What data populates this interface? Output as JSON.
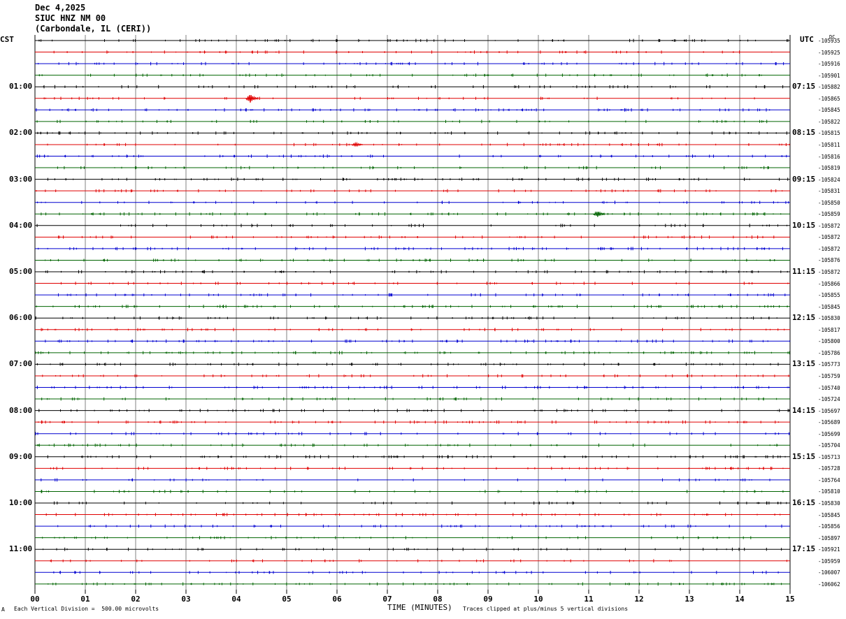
{
  "header": {
    "date": "Dec 4,2025",
    "station": "SIUC HNZ NM 00",
    "location": "(Carbondale, IL (CERI))"
  },
  "labels": {
    "left_zone": "CST",
    "right_zone": "UTC",
    "dc": "DC",
    "xlabel": "TIME (MINUTES)",
    "scale_note": "Each Vertical Division =  500.00 microvolts",
    "clip_note": "Traces clipped at plus/minus 5 vertical divisions",
    "corner_mark": "A"
  },
  "colors": {
    "black": "#000000",
    "red": "#e00000",
    "blue": "#0000d0",
    "green": "#006400",
    "grid": "#808080"
  },
  "chart_data": {
    "type": "line",
    "title": "SIUC HNZ NM 00",
    "xlabel": "TIME (MINUTES)",
    "x_ticks": [
      "00",
      "01",
      "02",
      "03",
      "04",
      "05",
      "06",
      "07",
      "08",
      "09",
      "10",
      "11",
      "12",
      "13",
      "14",
      "15"
    ],
    "xlim": [
      0,
      15
    ],
    "trace_count": 48,
    "trace_color_cycle": [
      "black",
      "red",
      "blue",
      "green"
    ],
    "left_hour_labels": [
      "01:00",
      "02:00",
      "03:00",
      "04:00",
      "05:00",
      "06:00",
      "07:00",
      "08:00",
      "09:00",
      "10:00",
      "11:00"
    ],
    "right_hour_labels": [
      "07:15",
      "08:15",
      "09:15",
      "10:15",
      "11:15",
      "12:15",
      "13:15",
      "14:15",
      "15:15",
      "16:15",
      "17:15"
    ],
    "dc_offsets": [
      "-105935",
      "-105925",
      "-105916",
      "-105901",
      "-105882",
      "-105865",
      "-105845",
      "-105822",
      "-105815",
      "-105811",
      "-105816",
      "-105819",
      "-105824",
      "-105831",
      "-105850",
      "-105859",
      "-105872",
      "-105872",
      "-105872",
      "-105876",
      "-105872",
      "-105866",
      "-105855",
      "-105845",
      "-105830",
      "-105817",
      "-105800",
      "-105786",
      "-105773",
      "-105759",
      "-105740",
      "-105724",
      "-105697",
      "-105689",
      "-105699",
      "-105704",
      "-105713",
      "-105728",
      "-105764",
      "-105810",
      "-105830",
      "-105845",
      "-105856",
      "-105897",
      "-105921",
      "-105959",
      "-106007",
      "-106062"
    ],
    "events": [
      {
        "trace": 5,
        "minute": 4.3,
        "amplitude": "large"
      },
      {
        "trace": 9,
        "minute": 6.4,
        "amplitude": "small"
      },
      {
        "trace": 15,
        "minute": 11.2,
        "amplitude": "medium"
      }
    ],
    "grid": true
  }
}
